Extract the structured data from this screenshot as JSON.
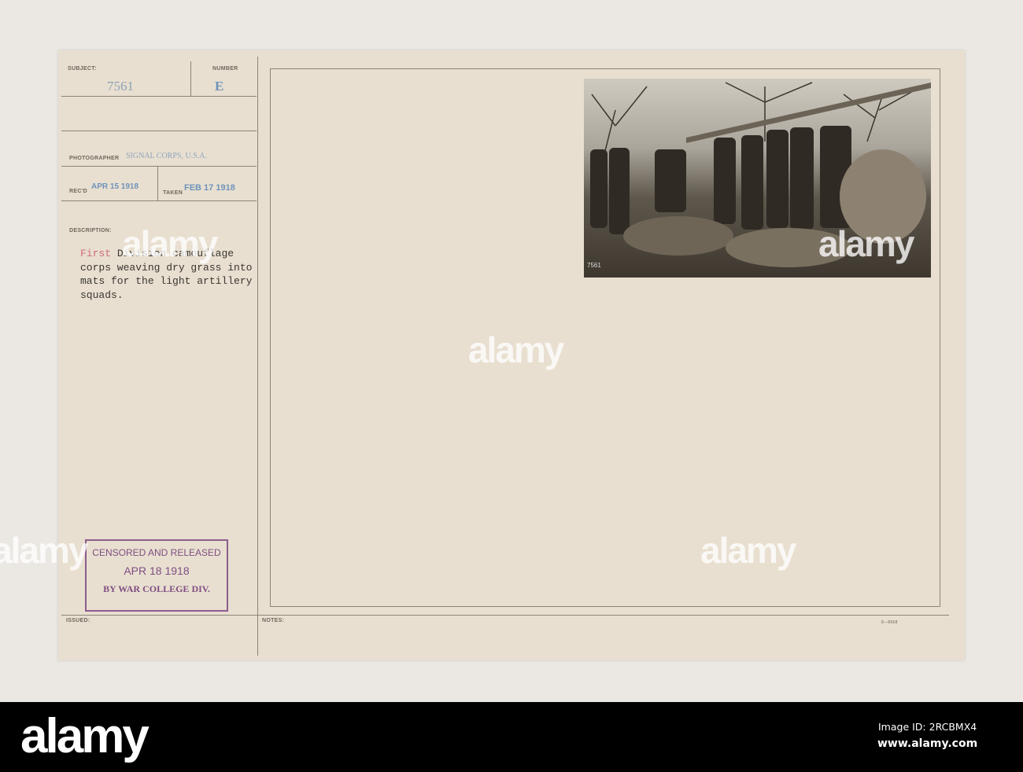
{
  "card": {
    "subject_label": "SUBJECT:",
    "subject_value": "7561",
    "number_label": "NUMBER",
    "number_value": "E",
    "photographer_label": "PHOTOGRAPHER",
    "photographer_value": "SIGNAL CORPS, U.S.A.",
    "recd_label": "REC'D",
    "recd_value": "APR 15 1918",
    "taken_label": "TAKEN",
    "taken_value": "FEB 17 1918",
    "description_label": "DESCRIPTION:",
    "description_first_word": "First",
    "description_rest": " Division camouflage\ncorps weaving dry grass into\nmats for the light artillery\nsquads.",
    "stamp": {
      "line1": "CENSORED AND RELEASED",
      "line2": "APR 18 1918",
      "line3": "BY WAR COLLEGE DIV."
    },
    "issued_label": "ISSUED:",
    "notes_label": "NOTES:",
    "form_number": "8—8668",
    "photo_number": "7561"
  },
  "watermark": "alamy",
  "footer": {
    "logo": "alamy",
    "image_id": "Image ID: 2RCBMX4",
    "url": "www.alamy.com"
  }
}
